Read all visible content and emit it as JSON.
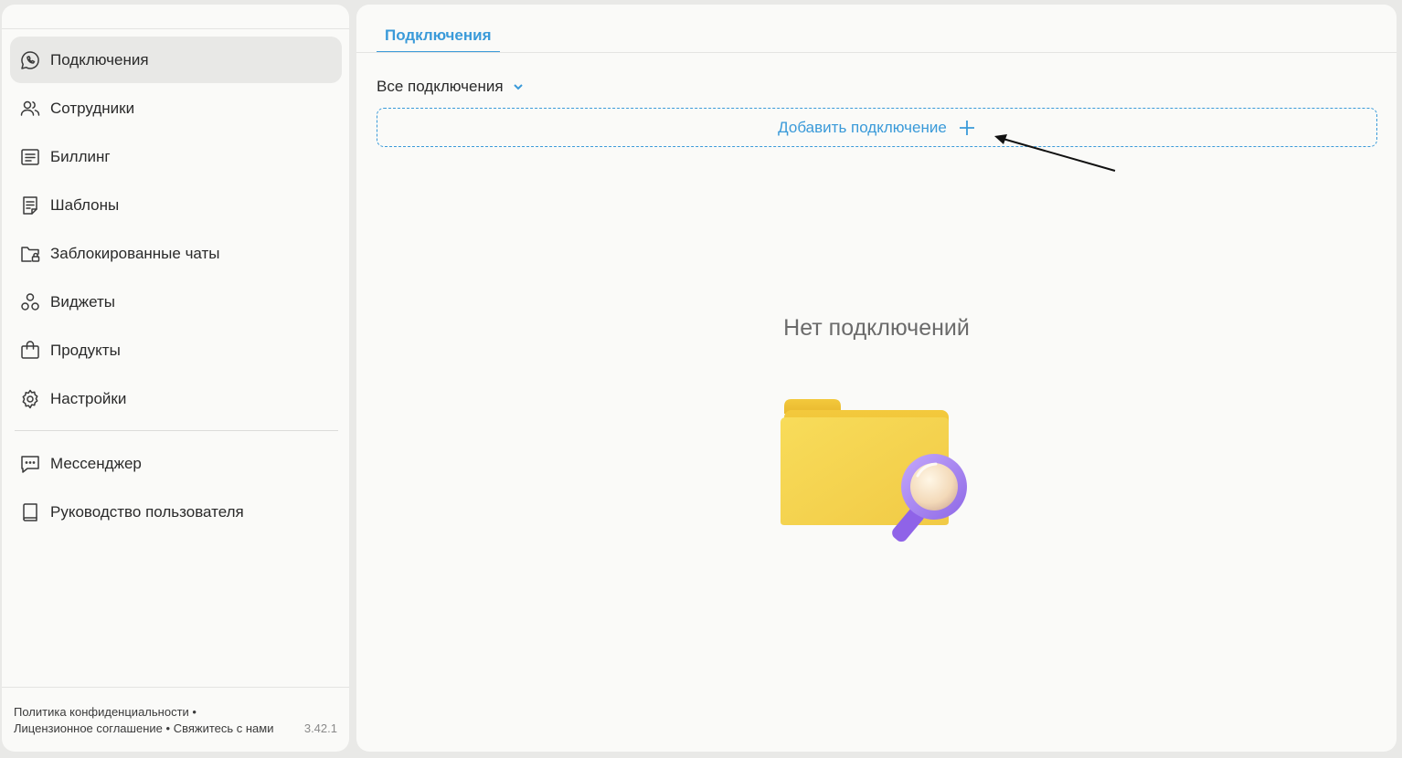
{
  "sidebar": {
    "items": [
      {
        "label": "Подключения",
        "icon": "whatsapp-icon",
        "active": true
      },
      {
        "label": "Сотрудники",
        "icon": "users-icon"
      },
      {
        "label": "Биллинг",
        "icon": "receipt-icon"
      },
      {
        "label": "Шаблоны",
        "icon": "document-icon"
      },
      {
        "label": "Заблокированные чаты",
        "icon": "locked-folder-icon"
      },
      {
        "label": "Виджеты",
        "icon": "circles-icon"
      },
      {
        "label": "Продукты",
        "icon": "bag-icon"
      },
      {
        "label": "Настройки",
        "icon": "gear-icon"
      }
    ],
    "secondary": [
      {
        "label": "Мессенджер",
        "icon": "chat-icon"
      },
      {
        "label": "Руководство пользователя",
        "icon": "book-icon"
      }
    ],
    "footer": {
      "privacy": "Политика конфиденциальности",
      "license": "Лицензионное соглашение",
      "contact": "Свяжитесь с нами",
      "separator": "•",
      "version": "3.42.1"
    }
  },
  "main": {
    "tab": "Подключения",
    "filter_label": "Все подключения",
    "add_button": "Добавить подключение",
    "empty_title": "Нет подключений"
  },
  "colors": {
    "accent": "#3a9ad9",
    "active_bg": "#e8e8e6",
    "folder": "#f5d54f",
    "magnifier": "#a07ef0"
  }
}
